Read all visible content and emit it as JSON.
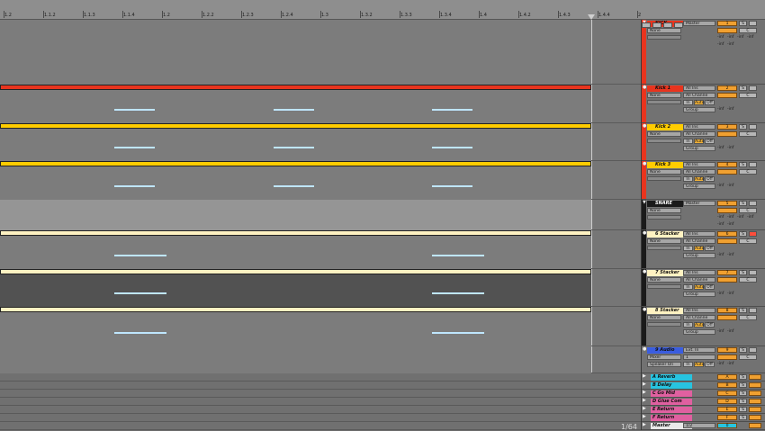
{
  "ruler": {
    "labels": [
      "1.2",
      "1.1.2",
      "1.1.3",
      "1.1.4",
      "1.2",
      "1.2.2",
      "1.2.3",
      "1.2.4",
      "1.3",
      "1.3.2",
      "1.3.3",
      "1.3.4",
      "1.4",
      "1.4.2",
      "1.4.3",
      "1.4.4",
      "2"
    ]
  },
  "colors": {
    "red": "#e8341e",
    "yellow": "#ffcc00",
    "cream": "#fff2c2",
    "cyan": "#27c4e0",
    "orange": "#f0a030",
    "blue": "#3a5de0",
    "pink": "#e060a0"
  },
  "tracks": [
    {
      "name": "KICK",
      "color": "#e8341e",
      "folder": true,
      "input": "None",
      "output": "Master",
      "num": "1",
      "s": "S",
      "pan": "C",
      "sends": [
        "-inf",
        "-inf",
        "-inf",
        "-inf"
      ],
      "vol": [
        "-inf",
        "-inf"
      ]
    },
    {
      "name": "Kick 1",
      "color": "#e8341e",
      "input": "All Ins",
      "channel": "All Channe",
      "monitor": [
        "In",
        "Auto",
        "Off"
      ],
      "out": "None",
      "group": "Group",
      "num": "2",
      "s": "S",
      "pan": "C",
      "vol": [
        "-inf",
        "-inf"
      ]
    },
    {
      "name": "Kick 2",
      "color": "#ffcc00",
      "input": "All Ins",
      "channel": "All Channe",
      "monitor": [
        "In",
        "Auto",
        "Off"
      ],
      "out": "None",
      "group": "Group",
      "num": "3",
      "s": "S",
      "pan": "C",
      "vol": [
        "-inf",
        "-inf"
      ]
    },
    {
      "name": "Kick 3",
      "color": "#ffcc00",
      "input": "All Ins",
      "channel": "All Channe",
      "monitor": [
        "In",
        "Auto",
        "Off"
      ],
      "out": "None",
      "group": "Group",
      "num": "4",
      "s": "S",
      "pan": "C",
      "vol": [
        "-inf",
        "-inf"
      ]
    },
    {
      "name": "SNARE",
      "color": "#1a1a1a",
      "folder": true,
      "input": "None",
      "output": "Master",
      "num": "5",
      "s": "S",
      "pan": "C",
      "sends": [
        "-inf",
        "-inf",
        "-inf",
        "-inf"
      ],
      "vol": [
        "-inf",
        "-inf"
      ]
    },
    {
      "name": "6 Stacker",
      "color": "#fff2c2",
      "input": "All Ins",
      "channel": "All Channe",
      "monitor": [
        "In",
        "Auto",
        "Off"
      ],
      "out": "None",
      "group": "Group",
      "num": "6",
      "s": "S",
      "pan": "C",
      "vol": [
        "-inf",
        "-inf"
      ]
    },
    {
      "name": "7 Stacker",
      "color": "#fff2c2",
      "input": "All Ins",
      "channel": "All Channe",
      "monitor": [
        "In",
        "Auto",
        "Off"
      ],
      "out": "None",
      "group": "Group",
      "num": "7",
      "s": "S",
      "pan": "C",
      "vol": [
        "-inf",
        "-inf"
      ]
    },
    {
      "name": "8 Stacker",
      "color": "#fff2c2",
      "input": "All Ins",
      "channel": "All Channe",
      "monitor": [
        "In",
        "Auto",
        "Off"
      ],
      "out": "None",
      "group": "Group",
      "num": "8",
      "s": "S",
      "pan": "C",
      "vol": [
        "-inf",
        "-inf"
      ]
    },
    {
      "name": "9 Audio",
      "color": "#3a5de0",
      "input": "Ext. In",
      "channel": "1",
      "out": "Mixer",
      "monitorOut": "Speaker On",
      "monitor": [
        "In",
        "Auto",
        "Off"
      ],
      "num": "9",
      "s": "S",
      "pan": "C",
      "vol": [
        "-inf",
        "-inf"
      ]
    }
  ],
  "returns": [
    {
      "name": "A Reverb",
      "color": "#27c4e0",
      "num": "A",
      "s": "S"
    },
    {
      "name": "B Delay",
      "color": "#27c4e0",
      "num": "B",
      "s": "S"
    },
    {
      "name": "C Go Mid",
      "color": "#e060a0",
      "num": "C",
      "s": "S"
    },
    {
      "name": "D Glue Com",
      "color": "#e060a0",
      "num": "D",
      "s": "S"
    },
    {
      "name": "E Return",
      "color": "#e060a0",
      "num": "E",
      "s": "S"
    },
    {
      "name": "F Return",
      "color": "#e060a0",
      "num": "F",
      "s": "S"
    },
    {
      "name": "Master",
      "color": "#e9e9e9",
      "num": "0",
      "sel": "1/2"
    }
  ],
  "footer": {
    "zoom": "1/64"
  }
}
